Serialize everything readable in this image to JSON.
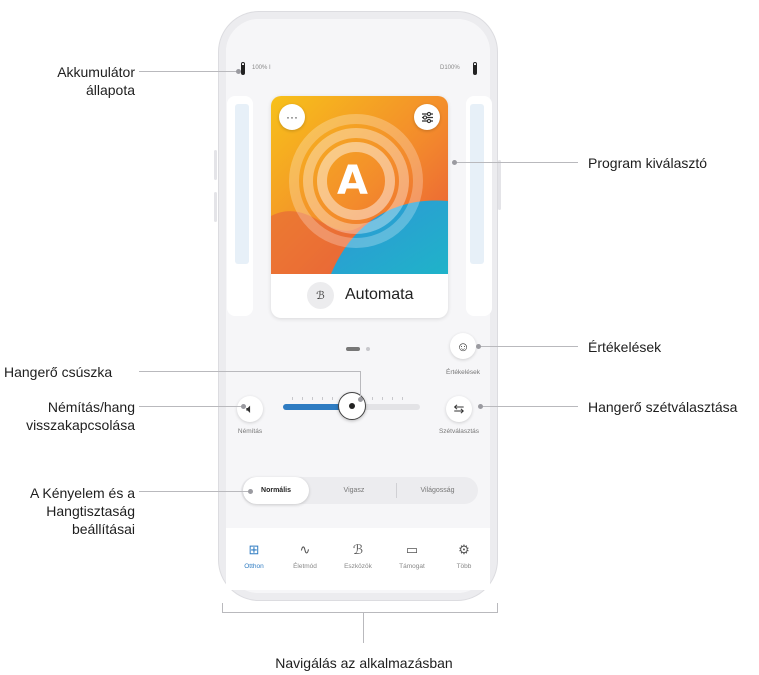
{
  "status": {
    "left_battery": "100% I",
    "right_battery": "D100%"
  },
  "program": {
    "letter": "A",
    "name": "Automata",
    "more_icon": "more-dots-icon",
    "settings_icon": "sliders-icon",
    "program_icon": "hearing-aid-icon"
  },
  "pager": {
    "pages": 2,
    "active": 0
  },
  "ratings": {
    "label": "Értékelések",
    "icon": "smiley-icon"
  },
  "mute": {
    "label": "Némítás",
    "icon": "speaker-icon"
  },
  "volume": {
    "level": 0.5
  },
  "split": {
    "label": "Szétválasztás",
    "icon": "split-arrows-icon"
  },
  "modes": {
    "items": [
      "Normális",
      "Vigasz",
      "Világosság"
    ],
    "selected": 0
  },
  "nav": {
    "items": [
      {
        "label": "Otthon",
        "icon": "home-grid-icon",
        "active": true
      },
      {
        "label": "Életmód",
        "icon": "activity-icon",
        "active": false
      },
      {
        "label": "Eszközök",
        "icon": "hearing-aid-icon",
        "active": false
      },
      {
        "label": "Támogat",
        "icon": "chat-bubble-icon",
        "active": false
      },
      {
        "label": "Több",
        "icon": "gear-icon",
        "active": false
      }
    ]
  },
  "annotations": {
    "battery": "Akkumulátor állapota",
    "program_selector": "Program kiválasztó",
    "ratings": "Értékelések",
    "volume_slider": "Hangerő csúszka",
    "mute": "Némítás/hang visszakapcsolása",
    "split": "Hangerő szétválasztása",
    "comfort": "A Kényelem és a Hangtisztaság beállításai",
    "navigation": "Navigálás az alkalmazásban"
  }
}
